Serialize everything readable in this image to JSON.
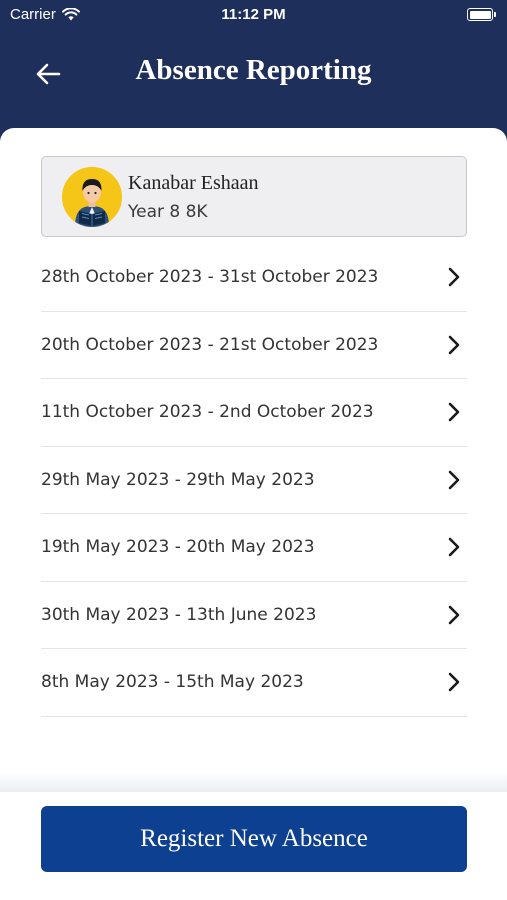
{
  "status_bar": {
    "carrier": "Carrier",
    "time": "11:12 PM",
    "battery_level": 1.0
  },
  "header": {
    "title": "Absence Reporting",
    "back_icon": "arrow-left-icon"
  },
  "student": {
    "name": "Kanabar Eshaan",
    "class": "Year 8 8K",
    "avatar_icon": "student-reading-avatar"
  },
  "absences": [
    {
      "label": "28th October 2023 - 31st October 2023"
    },
    {
      "label": "20th October 2023 - 21st October 2023"
    },
    {
      "label": "11th October 2023 - 2nd October 2023"
    },
    {
      "label": "29th May 2023 - 29th May 2023"
    },
    {
      "label": "19th May 2023 - 20th May 2023"
    },
    {
      "label": "30th May 2023 - 13th June 2023"
    },
    {
      "label": "8th May 2023 - 15th May 2023"
    }
  ],
  "footer": {
    "register_label": "Register New Absence"
  },
  "colors": {
    "header_bg": "#1f2f5c",
    "button_bg": "#0d4090",
    "avatar_bg": "#f5c518"
  }
}
